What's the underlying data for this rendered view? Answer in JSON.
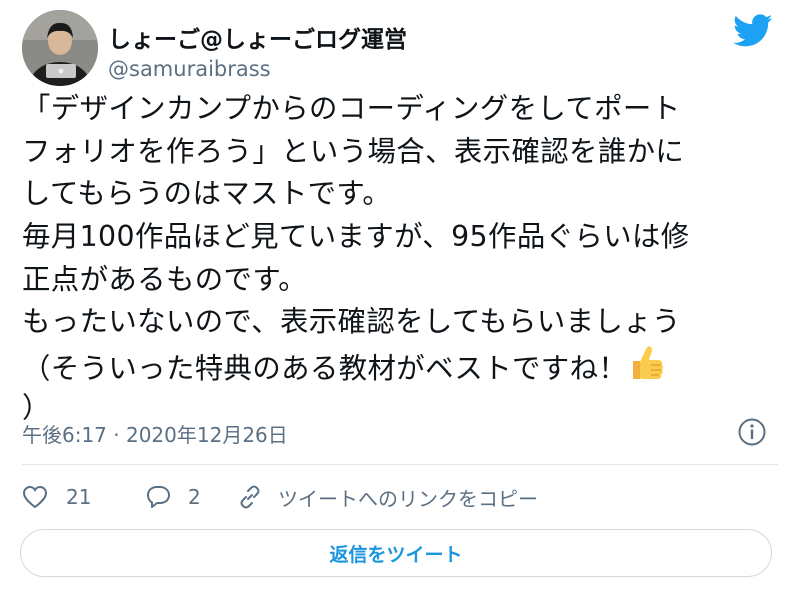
{
  "author": {
    "display_name": "しょーご@しょーごログ運営",
    "handle": "@samuraibrass"
  },
  "tweet": {
    "lines": [
      "「デザインカンプからのコーディングをしてポート",
      "フォリオを作ろう」という場合、表示確認を誰かに",
      "してもらうのはマストです。",
      "毎月100作品ほど見ていますが、95作品ぐらいは修",
      "正点があるものです。",
      "もったいないので、表示確認をしてもらいましょう",
      "（そういった特典のある教材がベストですね！",
      "）"
    ],
    "emoji": "thumbs-up",
    "timestamp": "午後6:17 · 2020年12月26日"
  },
  "actions": {
    "likes": "21",
    "replies": "2",
    "copy_link_label": "ツイートへのリンクをコピー"
  },
  "reply_button": {
    "label": "返信をツイート"
  },
  "colors": {
    "twitter_blue": "#1da1f2",
    "link_blue": "#1b95e0",
    "secondary_text": "#5b7083"
  },
  "icons": [
    "twitter-bird-icon",
    "info-icon",
    "heart-icon",
    "reply-bubble-icon",
    "link-icon",
    "thumbs-up-emoji"
  ]
}
